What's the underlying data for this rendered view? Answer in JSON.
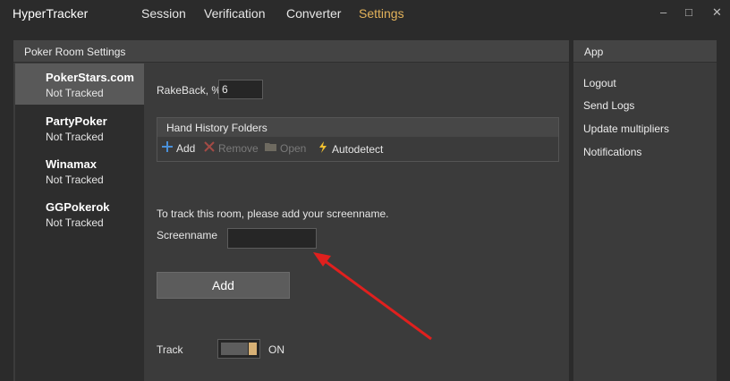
{
  "app": {
    "title": "HyperTracker"
  },
  "nav": [
    {
      "label": "Session",
      "active": false
    },
    {
      "label": "Verification",
      "active": false
    },
    {
      "label": "Converter",
      "active": false
    },
    {
      "label": "Settings",
      "active": true
    }
  ],
  "window_controls": {
    "minimize": "–",
    "maximize": "□",
    "close": "✕"
  },
  "poker_room_settings": {
    "title": "Poker Room Settings",
    "rooms": [
      {
        "name": "PokerStars.com",
        "status": "Not Tracked",
        "selected": true
      },
      {
        "name": "PartyPoker",
        "status": "Not Tracked",
        "selected": false
      },
      {
        "name": "Winamax",
        "status": "Not Tracked",
        "selected": false
      },
      {
        "name": "GGPokerok",
        "status": "Not Tracked",
        "selected": false
      }
    ],
    "rakeback": {
      "label": "RakeBack, %",
      "value": "6"
    },
    "hand_history": {
      "title": "Hand History Folders",
      "tools": [
        {
          "label": "Add",
          "icon": "plus-icon",
          "enabled": true
        },
        {
          "label": "Remove",
          "icon": "x-icon",
          "enabled": false
        },
        {
          "label": "Open",
          "icon": "folder-icon",
          "enabled": false
        },
        {
          "label": "Autodetect",
          "icon": "lightning-icon",
          "enabled": true
        }
      ]
    },
    "track_prompt": "To track this room, please add your screenname.",
    "screenname": {
      "label": "Screenname",
      "value": "",
      "placeholder": ""
    },
    "add_button": "Add",
    "track": {
      "label": "Track",
      "state": "ON"
    }
  },
  "app_panel": {
    "title": "App",
    "links": [
      "Logout",
      "Send Logs",
      "Update multipliers",
      "Notifications"
    ]
  },
  "colors": {
    "accent": "#e3b25a",
    "annotation_arrow": "#e0201e",
    "add_icon": "#4a90d9",
    "remove_icon": "#a34b45",
    "autodetect_icon": "#f0c030"
  }
}
